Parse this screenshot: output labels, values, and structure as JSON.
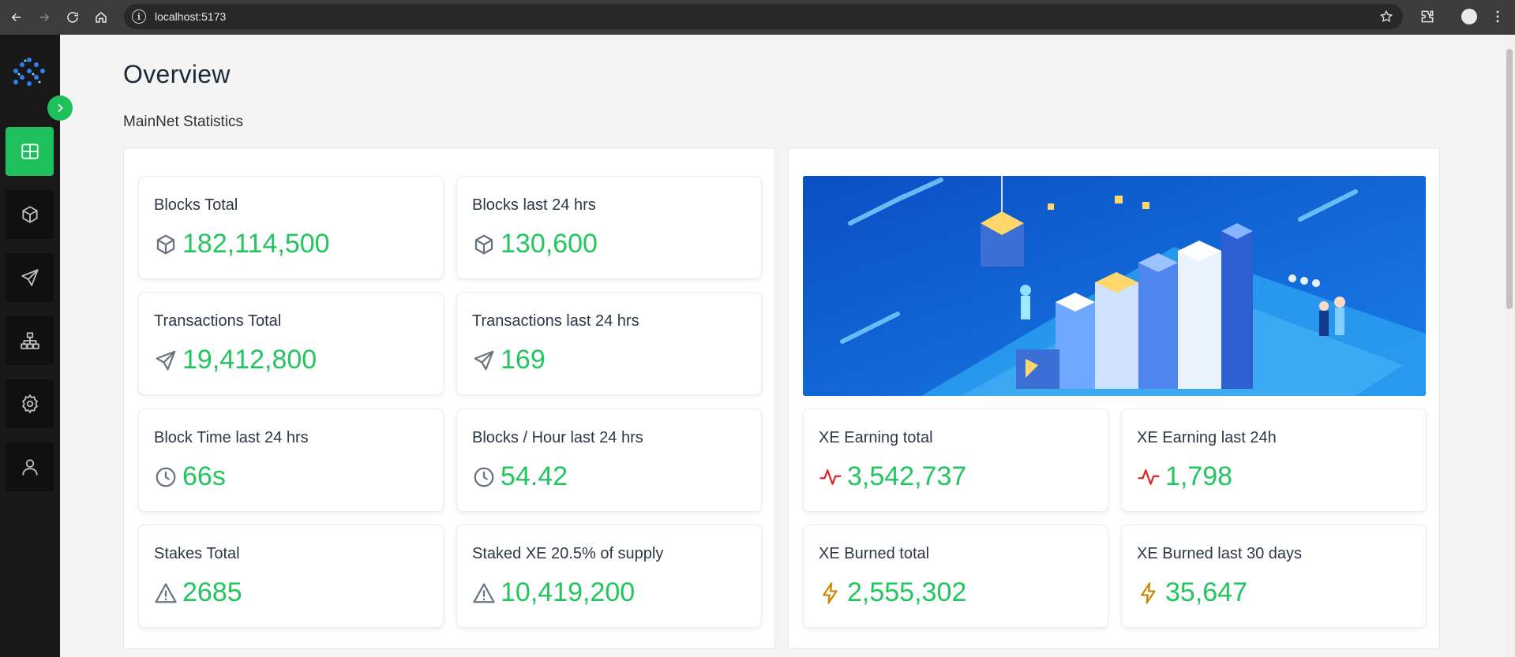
{
  "browser": {
    "url": "localhost:5173",
    "icons": [
      "back-icon",
      "forward-icon",
      "reload-icon",
      "home-icon",
      "info-icon",
      "star-icon",
      "extensions-icon",
      "profile-icon",
      "menu-icon"
    ]
  },
  "sidebar": {
    "items": [
      {
        "name": "overview",
        "icon": "grid-icon",
        "active": true
      },
      {
        "name": "blocks",
        "icon": "cube-icon"
      },
      {
        "name": "transactions",
        "icon": "send-icon"
      },
      {
        "name": "network",
        "icon": "network-icon"
      },
      {
        "name": "settings",
        "icon": "gear-icon"
      },
      {
        "name": "account",
        "icon": "user-icon"
      }
    ]
  },
  "page": {
    "title": "Overview",
    "section": "MainNet Statistics"
  },
  "stats": [
    {
      "label": "Blocks Total",
      "value": "182,114,500",
      "icon": "cube-icon"
    },
    {
      "label": "Blocks last 24 hrs",
      "value": "130,600",
      "icon": "cube-icon"
    },
    {
      "label": "Transactions Total",
      "value": "19,412,800",
      "icon": "send-icon"
    },
    {
      "label": "Transactions last 24 hrs",
      "value": "169",
      "icon": "send-icon"
    },
    {
      "label": "Block Time last 24 hrs",
      "value": "66s",
      "icon": "clock-icon"
    },
    {
      "label": "Blocks / Hour last 24 hrs",
      "value": "54.42",
      "icon": "clock-icon"
    },
    {
      "label": "Stakes Total",
      "value": "2685",
      "icon": "warning-icon"
    },
    {
      "label": "Staked XE 20.5% of supply",
      "value": "10,419,200",
      "icon": "warning-icon"
    }
  ],
  "xe": [
    {
      "label": "XE Earning total",
      "value": "3,542,737",
      "icon": "activity-icon"
    },
    {
      "label": "XE Earning last 24h",
      "value": "1,798",
      "icon": "activity-icon"
    },
    {
      "label": "XE Burned total",
      "value": "2,555,302",
      "icon": "lightning-icon"
    },
    {
      "label": "XE Burned last 30 days",
      "value": "35,647",
      "icon": "lightning-icon"
    }
  ],
  "colors": {
    "accent": "#1ec05c",
    "value": "#22c55e",
    "earning_icon": "#dc2626",
    "burned_icon": "#ca8a04",
    "banner_blue": "#0b59cf"
  }
}
